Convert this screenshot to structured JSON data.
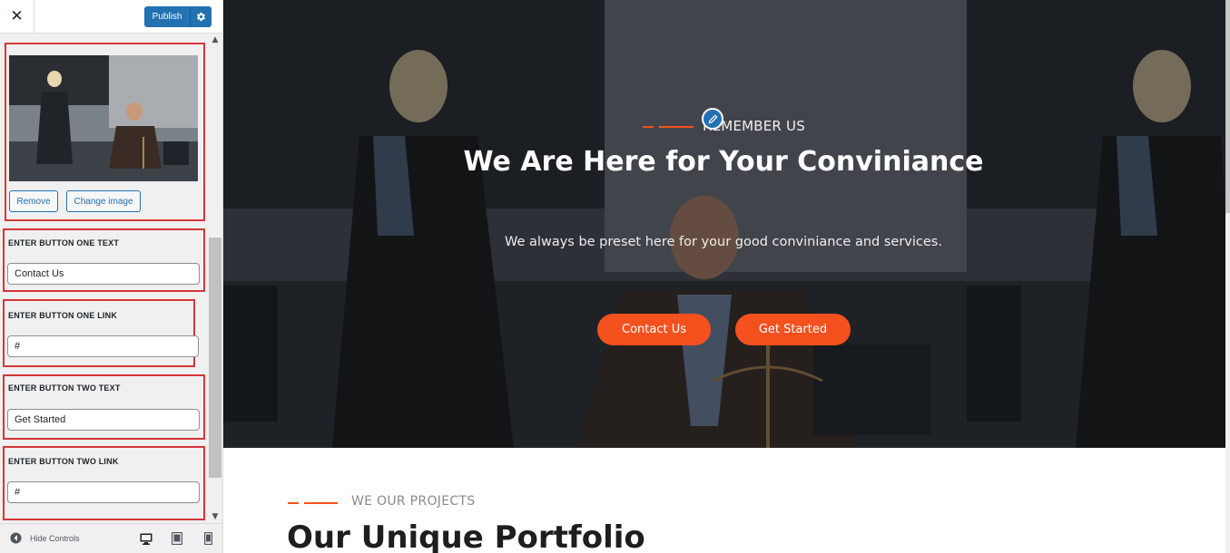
{
  "colors": {
    "wp_blue": "#2271b1",
    "accent_orange": "#f4511e",
    "highlight_red": "#d63638",
    "sidebar_bg": "#f0f0f1"
  },
  "customizer": {
    "close_icon": "close-icon",
    "publish_label": "Publish",
    "settings_icon": "gear-icon",
    "image_control": {
      "remove_label": "Remove",
      "change_label": "Change image"
    },
    "fields": [
      {
        "label": "ENTER BUTTON ONE TEXT",
        "value": "Contact Us"
      },
      {
        "label": "ENTER BUTTON ONE LINK",
        "value": "#"
      },
      {
        "label": "ENTER BUTTON TWO TEXT",
        "value": "Get Started"
      },
      {
        "label": "ENTER BUTTON TWO LINK",
        "value": "#"
      }
    ],
    "footer": {
      "hide_controls_label": "Hide Controls",
      "devices": [
        "desktop-icon",
        "tablet-icon",
        "mobile-icon"
      ]
    }
  },
  "preview": {
    "hero": {
      "subheading": "REMEMBER US",
      "title": "We Are Here for Your Conviniance",
      "text": "We always be preset here for your good conviniance and services.",
      "button_one": "Contact Us",
      "button_two": "Get Started"
    },
    "projects": {
      "subheading": "WE OUR PROJECTS",
      "title": "Our Unique Portfolio"
    }
  }
}
